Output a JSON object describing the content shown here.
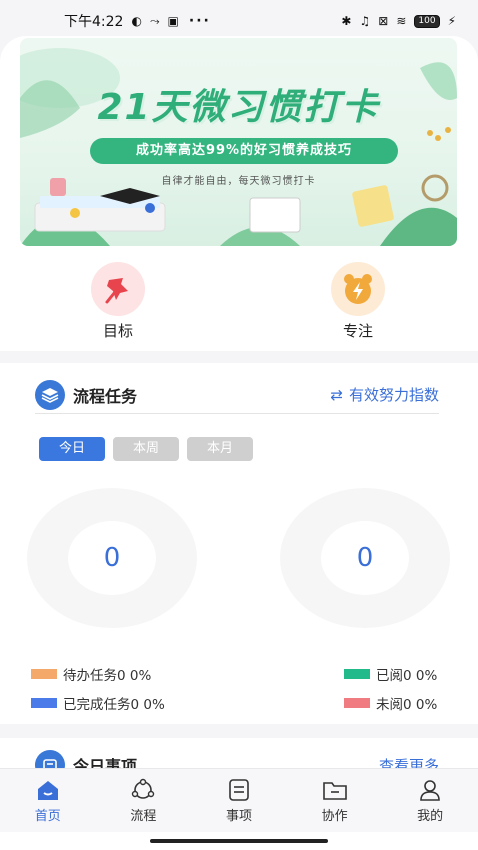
{
  "status_bar": {
    "time": "下午4:22",
    "dots": "···",
    "battery": "100"
  },
  "banner": {
    "title": "21天微习惯打卡",
    "pill": "成功率高达99%的好习惯养成技巧",
    "subtitle": "自律才能自由，每天微习惯打卡"
  },
  "shortcuts": [
    {
      "label": "目标",
      "icon": "pushpin-icon"
    },
    {
      "label": "专注",
      "icon": "alarm-clock-icon"
    }
  ],
  "process_section": {
    "title": "流程任务",
    "link": "有效努力指数",
    "tabs": [
      "今日",
      "本周",
      "本月"
    ],
    "active_tab": 0,
    "left_value": "0",
    "right_value": "0",
    "legend": {
      "pending": {
        "label": "待办任务0  0%",
        "color": "#f4a96a"
      },
      "done": {
        "label": "已完成任务0  0%",
        "color": "#4a7be8"
      },
      "read": {
        "label": "已阅0  0%",
        "color": "#22b98b"
      },
      "unread": {
        "label": "未阅0  0%",
        "color": "#f07b80"
      }
    }
  },
  "today_section": {
    "title": "今日事项",
    "link": "查看更多"
  },
  "bottom_nav": [
    {
      "label": "首页",
      "icon": "home-icon"
    },
    {
      "label": "流程",
      "icon": "flow-icon"
    },
    {
      "label": "事项",
      "icon": "list-icon"
    },
    {
      "label": "协作",
      "icon": "folder-icon"
    },
    {
      "label": "我的",
      "icon": "person-icon"
    }
  ],
  "colors": {
    "accent": "#3a6fd8",
    "banner_green": "#34b57f"
  }
}
